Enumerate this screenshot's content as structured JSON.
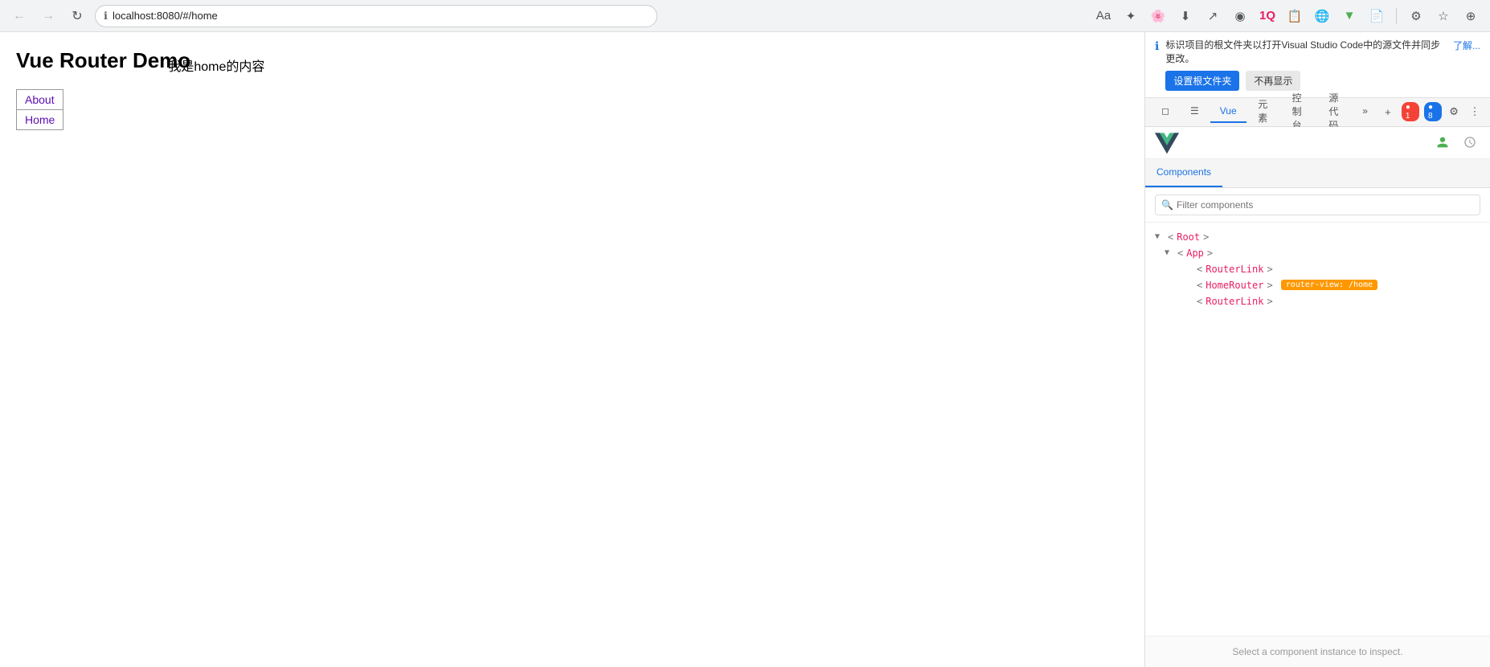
{
  "browser": {
    "back_btn": "←",
    "forward_btn": "→",
    "refresh_btn": "↻",
    "url": "localhost:8080/#/home",
    "toolbar_icons": [
      "Aa",
      "⭐",
      "🌸",
      "⬇",
      "🏹",
      "◉",
      "1Q",
      "📋",
      "🌐",
      "▼",
      "📄",
      "⚙",
      "★",
      "⊕"
    ]
  },
  "page": {
    "title": "Vue Router Demo",
    "nav_links": [
      {
        "label": "About",
        "href": "#/about",
        "active": false
      },
      {
        "label": "Home",
        "href": "#/home",
        "active": true
      }
    ],
    "content": "我是home的内容"
  },
  "devtools": {
    "notification": {
      "icon": "ℹ",
      "text": "标识项目的根文件夹以打开Visual Studio Code中的源文件并同步更改。",
      "btn_primary": "设置根文件夹",
      "btn_secondary": "不再显示",
      "close_text": "了解..."
    },
    "tabs": [
      {
        "label": "◻",
        "active": false
      },
      {
        "label": "☰",
        "active": false
      },
      {
        "label": "Vue",
        "active": true
      },
      {
        "label": "元素",
        "active": false
      },
      {
        "label": "控制台",
        "active": false
      },
      {
        "label": "源代码",
        "active": false
      },
      {
        "label": "»",
        "active": false
      }
    ],
    "toolbar_icons": [
      "+",
      "1",
      "8",
      "⚙",
      "⊞"
    ],
    "error_count": "● 1",
    "warn_count": "● 8",
    "vue_toolbar": {
      "tabs": [
        "Components",
        "History"
      ],
      "active_tab": "Components"
    },
    "filter_placeholder": "Filter components",
    "component_tree": [
      {
        "indent": 0,
        "arrow": "▼",
        "name": "Root",
        "angle_open": "<",
        "angle_close": ">",
        "badge": null
      },
      {
        "indent": 1,
        "arrow": "▼",
        "name": "App",
        "angle_open": "<",
        "angle_close": ">",
        "badge": null
      },
      {
        "indent": 2,
        "arrow": " ",
        "name": "RouterLink",
        "angle_open": "<",
        "angle_close": ">",
        "badge": null
      },
      {
        "indent": 2,
        "arrow": " ",
        "name": "HomeRouter",
        "angle_open": "<",
        "angle_close": ">",
        "badge": "router-view: /home"
      },
      {
        "indent": 2,
        "arrow": " ",
        "name": "RouterLink",
        "angle_open": "<",
        "angle_close": ">",
        "badge": null
      }
    ],
    "bottom_text": "Select a component instance to inspect."
  }
}
